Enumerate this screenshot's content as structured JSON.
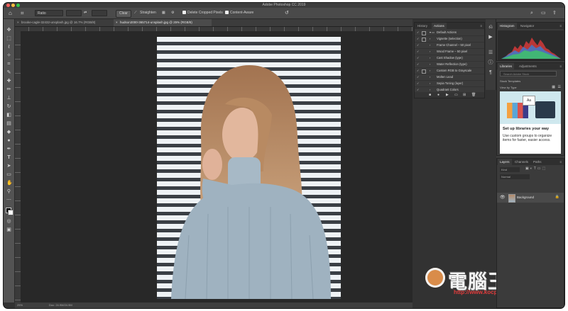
{
  "app": {
    "title": "Adobe Photoshop CC 2019"
  },
  "options": {
    "ratio_value": "Ratio",
    "clear_label": "Clear",
    "straighten_label": "Straighten",
    "delete_cropped_label": "Delete Cropped Pixels",
    "content_aware_label": "Content-Aware"
  },
  "documents": {
    "tabs": [
      {
        "label": "brooke-cagle-32432-unsplash.jpg @ 16.7% (RGB/8)"
      },
      {
        "label": "hudson2000-365714-unsplash.jpg @ 25% (RGB/8)"
      }
    ]
  },
  "status": {
    "zoom": "25%",
    "doc": "Doc: 24.9M/24.9M"
  },
  "actions_panel": {
    "tabs": [
      "History",
      "Actions"
    ],
    "rows": [
      "Default Actions",
      "Vignette (selection)",
      "Frame Channel – 50 pixel",
      "Wood Frame – 50 pixel",
      "Cast Shadow (type)",
      "Water Reflection (type)",
      "Custom RGB to Grayscale",
      "Molten Lead",
      "Sepia Toning (layer)",
      "Quadrant Colors"
    ]
  },
  "histogram_panel": {
    "tabs": [
      "Histogram",
      "Navigator"
    ]
  },
  "libraries_panel": {
    "tabs": [
      "Libraries",
      "Adjustments"
    ],
    "search_placeholder": "Search Adobe Stock",
    "library_name": "Stock Templates",
    "view_by": "View by Type",
    "card_title": "Set up libraries your way",
    "card_text": "Use custom groups to organize items for faster, easier access."
  },
  "layers_panel": {
    "tabs": [
      "Layers",
      "Channels",
      "Paths"
    ],
    "kind_label": "Kind",
    "mode_label": "Normal",
    "layer_name": "Background"
  },
  "watermark": {
    "name": "電腦王阿達",
    "url": "http://www.kocpc.com.tw"
  },
  "colors": {
    "accent": "#1473e6",
    "panel": "#3b3b3b",
    "canvas_bg": "#282828"
  }
}
